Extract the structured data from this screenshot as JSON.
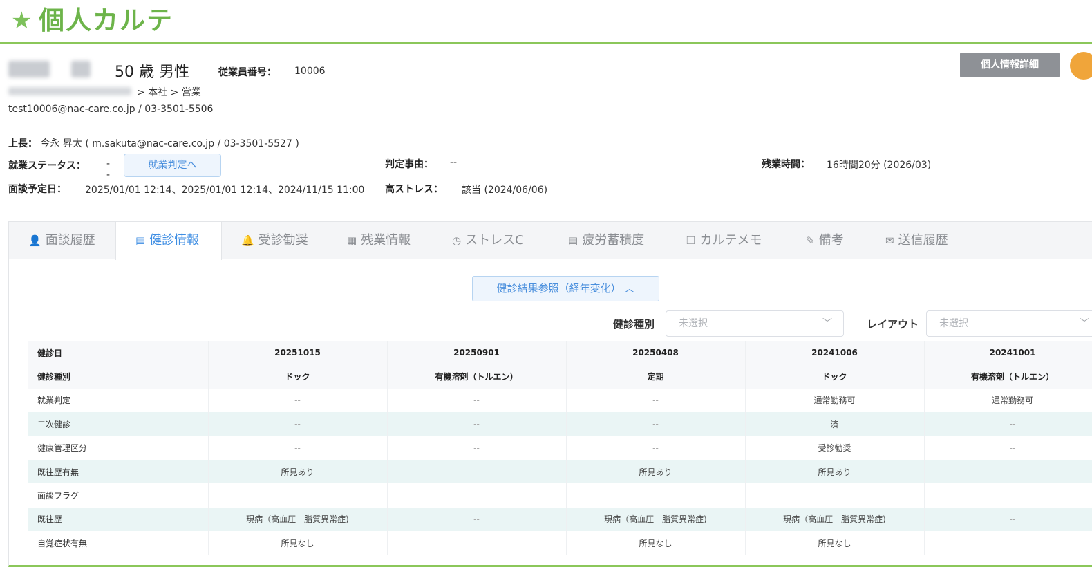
{
  "page": {
    "title": "個人カルテ"
  },
  "profile": {
    "age_gender": "50 歳 男性",
    "employee_no_label": "従業員番号：",
    "employee_no": "10006",
    "dept_path": "> 本社 > 営業",
    "contact": "test10006@nac-care.co.jp / 03-3501-5506",
    "boss_label": "上長：",
    "boss_value": "今永 昇太 ( m.sakuta@nac-care.co.jp / 03-3501-5527 )",
    "detail_button": "個人情報詳細"
  },
  "status": {
    "employment_label": "就業ステータス：",
    "employment_value": "--",
    "judge_button": "就業判定へ",
    "reason_label": "判定事由：",
    "reason_value": "--",
    "overtime_label": "残業時間：",
    "overtime_value": "16時間20分 (2026/03)",
    "interview_label": "面談予定日：",
    "interview_value": "2025/01/01 12:14、2025/01/01 12:14、2024/11/15 11:00",
    "stress_label": "高ストレス：",
    "stress_value": "該当 (2024/06/06)"
  },
  "tabs": [
    {
      "label": "面談履歴",
      "icon": "person-icon"
    },
    {
      "label": "健診情報",
      "icon": "document-icon"
    },
    {
      "label": "受診勧奨",
      "icon": "bell-icon"
    },
    {
      "label": "残業情報",
      "icon": "briefcase-icon"
    },
    {
      "label": "ストレスC",
      "icon": "clock-icon"
    },
    {
      "label": "疲労蓄積度",
      "icon": "document-icon"
    },
    {
      "label": "カルテメモ",
      "icon": "copy-icon"
    },
    {
      "label": "備考",
      "icon": "pen-icon"
    },
    {
      "label": "送信履歴",
      "icon": "mail-icon"
    }
  ],
  "health": {
    "result_button": "健診結果参照（経年変化）",
    "type_label": "健診種別",
    "type_value": "未選択",
    "layout_label": "レイアウト",
    "layout_value": "未選択",
    "columns": [
      "20251015",
      "20250901",
      "20250408",
      "20241006",
      "20241001"
    ],
    "rows": [
      {
        "label": "健診日",
        "values": [
          "20251015",
          "20250901",
          "20250408",
          "20241006",
          "20241001"
        ]
      },
      {
        "label": "健診種別",
        "values": [
          "ドック",
          "有機溶剤（トルエン）",
          "定期",
          "ドック",
          "有機溶剤（トルエン）"
        ]
      },
      {
        "label": "就業判定",
        "values": [
          "--",
          "--",
          "--",
          "通常勤務可",
          "通常勤務可"
        ]
      },
      {
        "label": "二次健診",
        "values": [
          "--",
          "--",
          "--",
          "済",
          "--"
        ]
      },
      {
        "label": "健康管理区分",
        "values": [
          "--",
          "--",
          "--",
          "受診勧奨",
          "--"
        ]
      },
      {
        "label": "既往歴有無",
        "values": [
          "所見あり",
          "--",
          "所見あり",
          "所見あり",
          "--"
        ]
      },
      {
        "label": "面談フラグ",
        "values": [
          "--",
          "--",
          "--",
          "--",
          "--"
        ]
      },
      {
        "label": "既往歴",
        "values": [
          "現病（高血圧　脂質異常症)",
          "--",
          "現病（高血圧　脂質異常症)",
          "現病（高血圧　脂質異常症)",
          "--"
        ]
      },
      {
        "label": "自覚症状有無",
        "values": [
          "所見なし",
          "--",
          "所見なし",
          "所見なし",
          "--"
        ]
      }
    ]
  }
}
